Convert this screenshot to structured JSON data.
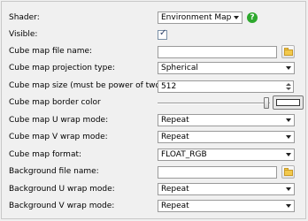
{
  "shader": {
    "label": "Shader:",
    "value": "Environment Map",
    "help_icon": "help-icon"
  },
  "visible": {
    "label": "Visible:",
    "checked": true
  },
  "cube_map_file": {
    "label": "Cube map file name:",
    "value": ""
  },
  "projection": {
    "label": "Cube map projection type:",
    "value": "Spherical"
  },
  "size": {
    "label": "Cube map size (must be power of two):",
    "value": "512"
  },
  "border_color": {
    "label": "Cube map border color",
    "swatch": "#ffffff"
  },
  "u_wrap": {
    "label": "Cube map U wrap mode:",
    "value": "Repeat"
  },
  "v_wrap": {
    "label": "Cube map V wrap mode:",
    "value": "Repeat"
  },
  "format": {
    "label": "Cube map format:",
    "value": "FLOAT_RGB"
  },
  "bg_file": {
    "label": "Background file name:",
    "value": ""
  },
  "bg_u_wrap": {
    "label": "Background U wrap mode:",
    "value": "Repeat"
  },
  "bg_v_wrap": {
    "label": "Background V wrap mode:",
    "value": "Repeat"
  }
}
